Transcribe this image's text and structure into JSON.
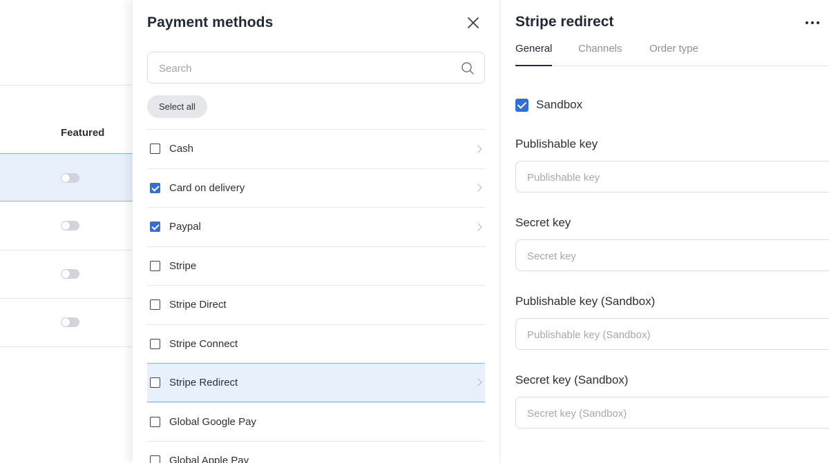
{
  "background_table": {
    "featured_header": "Featured",
    "rows": [
      {
        "featured": false,
        "selected": true
      },
      {
        "featured": false,
        "selected": false
      },
      {
        "featured": false,
        "selected": false
      },
      {
        "featured": false,
        "selected": false
      }
    ]
  },
  "payment_methods": {
    "title": "Payment methods",
    "search_placeholder": "Search",
    "select_all_label": "Select all",
    "items": [
      {
        "label": "Cash",
        "checked": false,
        "has_chevron": true
      },
      {
        "label": "Card on delivery",
        "checked": true,
        "has_chevron": true
      },
      {
        "label": "Paypal",
        "checked": true,
        "has_chevron": true
      },
      {
        "label": "Stripe",
        "checked": false,
        "has_chevron": false
      },
      {
        "label": "Stripe Direct",
        "checked": false,
        "has_chevron": false
      },
      {
        "label": "Stripe Connect",
        "checked": false,
        "has_chevron": false
      },
      {
        "label": "Stripe Redirect",
        "checked": false,
        "has_chevron": true,
        "selected": true
      },
      {
        "label": "Global Google Pay",
        "checked": false,
        "has_chevron": false
      },
      {
        "label": "Global Apple Pay",
        "checked": false,
        "has_chevron": false
      }
    ]
  },
  "detail": {
    "title": "Stripe redirect",
    "tabs": [
      {
        "label": "General",
        "active": true
      },
      {
        "label": "Channels",
        "active": false
      },
      {
        "label": "Order type",
        "active": false
      }
    ],
    "sandbox": {
      "label": "Sandbox",
      "checked": true
    },
    "fields": [
      {
        "label": "Publishable key",
        "placeholder": "Publishable key"
      },
      {
        "label": "Secret key",
        "placeholder": "Secret key"
      },
      {
        "label": "Publishable key (Sandbox)",
        "placeholder": "Publishable key (Sandbox)"
      },
      {
        "label": "Secret key (Sandbox)",
        "placeholder": "Secret key (Sandbox)"
      }
    ]
  },
  "colors": {
    "accent": "#2f6fd8",
    "selected_bg": "#e8f0fc",
    "selected_border": "#8fb0ea"
  }
}
